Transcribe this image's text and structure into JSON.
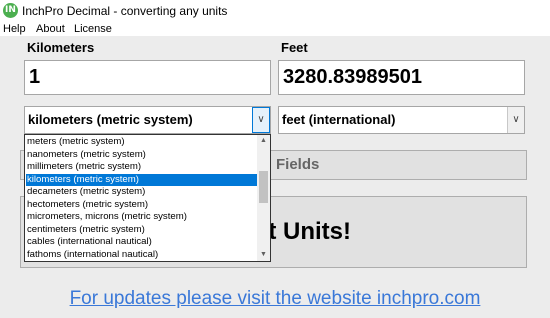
{
  "window": {
    "title": "InchPro Decimal - converting any units",
    "icon_letter": "IN"
  },
  "menu": [
    "Help",
    "About",
    "License"
  ],
  "left": {
    "label": "Kilometers",
    "value": "1",
    "unit": "kilometers (metric system)"
  },
  "right": {
    "label": "Feet",
    "value": "3280.83989501",
    "unit": "feet (international)"
  },
  "buttons": {
    "swap_partial": "Fields",
    "convert_partial": "rt Units!"
  },
  "dropdown": {
    "items": [
      "meters (metric system)",
      "nanometers (metric system)",
      "millimeters (metric system)",
      "kilometers (metric system)",
      "decameters (metric system)",
      "hectometers (metric system)",
      "micrometers, microns (metric system)",
      "centimeters (metric system)",
      "cables (international nautical)",
      "fathoms (international nautical)"
    ],
    "selected_index": 3
  },
  "footer_link": "For updates please visit the website inchpro.com",
  "colors": {
    "selection": "#0078d7",
    "link": "#3a78d8"
  }
}
